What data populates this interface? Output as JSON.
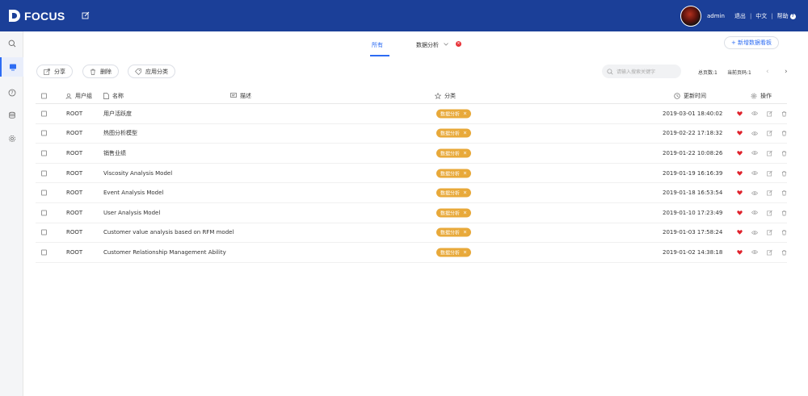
{
  "app": {
    "logo_text": "FOCUS",
    "user": "admin",
    "logout": "退出",
    "language": "中文",
    "help": "帮助"
  },
  "sidebar": {
    "items": [
      {
        "icon": "search-icon"
      },
      {
        "icon": "board-icon",
        "active": true
      },
      {
        "icon": "question-icon"
      },
      {
        "icon": "database-icon"
      },
      {
        "icon": "settings-icon"
      }
    ]
  },
  "tabs": {
    "all_label": "所有",
    "category_label": "数据分析",
    "new_board_label": "+ 新增数据看板"
  },
  "toolbar": {
    "share_label": "分享",
    "delete_label": "删除",
    "apply_category_label": "应用分类",
    "search_placeholder": "请输入搜索关键字",
    "total_pages": "总页数:1",
    "current_page": "当前页码:1",
    "prev": "‹",
    "next": "›"
  },
  "table": {
    "headers": {
      "group": "用户组",
      "name": "名称",
      "desc": "描述",
      "category": "分类",
      "updated": "更新时间",
      "actions": "操作"
    },
    "rows": [
      {
        "group": "ROOT",
        "name": "用户活跃度",
        "category": "数据分析",
        "updated": "2019-03-01 18:40:02"
      },
      {
        "group": "ROOT",
        "name": "热图分析模型",
        "category": "数据分析",
        "updated": "2019-02-22 17:18:32"
      },
      {
        "group": "ROOT",
        "name": "销售业绩",
        "category": "数据分析",
        "updated": "2019-01-22 10:08:26"
      },
      {
        "group": "ROOT",
        "name": "Viscosity Analysis Model",
        "category": "数据分析",
        "updated": "2019-01-19 16:16:39"
      },
      {
        "group": "ROOT",
        "name": "Event Analysis Model",
        "category": "数据分析",
        "updated": "2019-01-18 16:53:54"
      },
      {
        "group": "ROOT",
        "name": "User Analysis Model",
        "category": "数据分析",
        "updated": "2019-01-10 17:23:49"
      },
      {
        "group": "ROOT",
        "name": "Customer value analysis based on RFM model",
        "category": "数据分析",
        "updated": "2019-01-03 17:58:24"
      },
      {
        "group": "ROOT",
        "name": "Customer Relationship Management Ability",
        "category": "数据分析",
        "updated": "2019-01-02 14:38:18"
      }
    ]
  },
  "colors": {
    "topbar": "#1b3f98",
    "accent": "#2d6cf3",
    "tag": "#e8a93a",
    "favorite": "#e0212b"
  }
}
